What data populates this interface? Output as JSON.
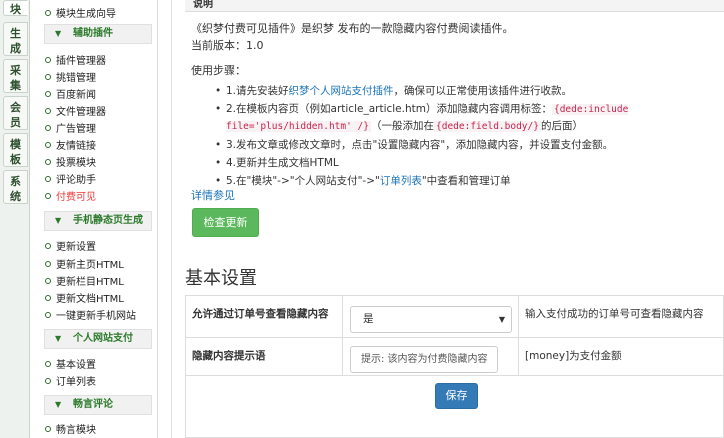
{
  "vertical_tabs": [
    "块",
    "生成",
    "采集",
    "会员",
    "模板",
    "系统"
  ],
  "sidebar": {
    "top_item": "模块生成向导",
    "sections": [
      {
        "title": "辅助插件",
        "items": [
          "插件管理器",
          "挑错管理",
          "百度新闻",
          "文件管理器",
          "广告管理",
          "友情链接",
          "投票模块",
          "评论助手",
          "付费可见"
        ]
      },
      {
        "title": "手机静态页生成",
        "items": [
          "更新设置",
          "更新主页HTML",
          "更新栏目HTML",
          "更新文档HTML",
          "一键更新手机网站"
        ]
      },
      {
        "title": "个人网站支付",
        "items": [
          "基本设置",
          "订单列表"
        ]
      },
      {
        "title": "畅言评论",
        "items": [
          "畅言模块"
        ]
      }
    ]
  },
  "header": {
    "title": "说明"
  },
  "intro": {
    "line1": "《织梦付费可见插件》是织梦 发布的一款隐藏内容付费阅读插件。",
    "version": "当前版本：1.0",
    "steps_label": "使用步骤："
  },
  "steps": [
    {
      "prefix": "1.请先安装好",
      "link": "织梦个人网站支付插件",
      "suffix": "，确保可以正常使用该插件进行收款。"
    },
    {
      "prefix": "2.在模板内容页（例如article_article.htm）添加隐藏内容调用标签：",
      "code": "{dede:include file='plus/hidden.htm' /}",
      "middle": "（一般添加在",
      "code2": "{dede:field.body/}",
      "suffix": "的后面）"
    },
    {
      "text": "3.发布文章或修改文章时，点击\"设置隐藏内容\"，添加隐藏内容，并设置支付金额。"
    },
    {
      "text": "4.更新并生成文档HTML"
    },
    {
      "prefix": "5.在\"模块\"->\"个人网站支付\"->\"",
      "link": "订单列表",
      "suffix": "\"中查看和管理订单"
    }
  ],
  "more_link": "详情参见",
  "check_update_button": "检查更新",
  "basic_settings": {
    "title": "基本设置",
    "rows": [
      {
        "label": "允许通过订单号查看隐藏内容",
        "selected": "是",
        "help": "输入支付成功的订单号可查看隐藏内容"
      },
      {
        "label": "隐藏内容提示语",
        "placeholder": "提示: 该内容为付费隐藏内容",
        "help": "[money]为支付金额"
      }
    ],
    "save_button": "保存"
  },
  "colors": {
    "green_button": "#5cb85c",
    "blue_button": "#337ab7",
    "link": "#1a73b8",
    "active_red": "#ee3333"
  }
}
